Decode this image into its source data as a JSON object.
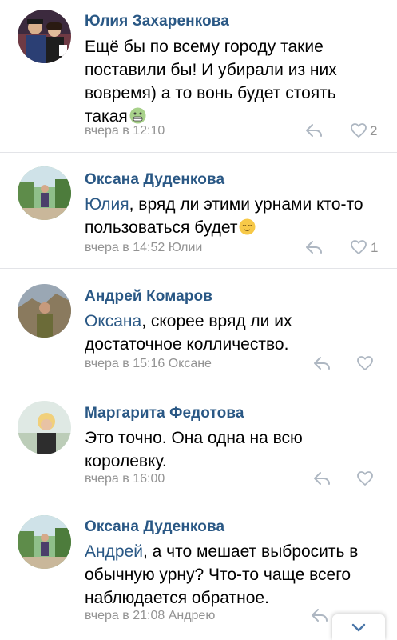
{
  "comments": [
    {
      "author": "Юлия Захаренкова",
      "mention": "",
      "text_line1": "Ещё бы по всему городу такие",
      "text_line2": "поставили бы! И убирали из них",
      "text_line3": "вовремя) а то вонь будет стоять",
      "text_line4": "такая",
      "emoji": "sick-face",
      "meta": "вчера в 12:10",
      "likes": "2"
    },
    {
      "author": "Оксана Дуденкова",
      "mention": "Юлия",
      "text_line1": ", вряд ли этими урнами кто-то",
      "text_line2": "пользоваться будет",
      "emoji": "relieved-face",
      "meta": "вчера в 14:52 Юлии",
      "likes": "1"
    },
    {
      "author": "Андрей Комаров",
      "mention": "Оксана",
      "text_line1": ", скорее вряд ли их",
      "text_line2": "достаточное колличество.",
      "meta": "вчера в 15:16 Оксане",
      "likes": ""
    },
    {
      "author": "Маргарита Федотова",
      "mention": "",
      "text_line1": "Это точно. Она одна на всю",
      "text_line2": "королевку.",
      "meta": "вчера в 16:00",
      "likes": ""
    },
    {
      "author": "Оксана Дуденкова",
      "mention": "Андрей",
      "text_line1": ", а что мешает выбросить в",
      "text_line2": "обычную урну? Что-то чаще всего",
      "text_line3": "наблюдается обратное.",
      "meta": "вчера в 21:08 Андрею",
      "likes": ""
    }
  ],
  "icons": {
    "reply": "reply-icon",
    "like": "heart-icon",
    "scroll": "chevron-down-icon"
  },
  "colors": {
    "author": "#2a5885",
    "meta": "#939393",
    "icon": "#aeb7c2"
  }
}
